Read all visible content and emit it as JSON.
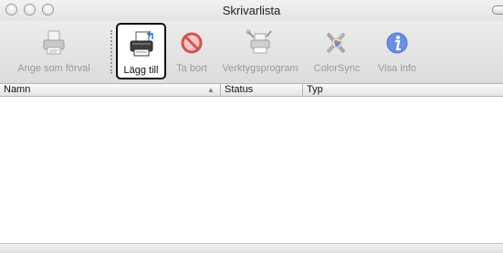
{
  "window": {
    "title": "Skrivarlista"
  },
  "toolbar": {
    "items": [
      {
        "label": "Ange som förval",
        "icon": "printer-default-icon",
        "enabled": false
      },
      {
        "label": "Lägg till",
        "icon": "add-printer-icon",
        "enabled": true,
        "selected": true
      },
      {
        "label": "Ta bort",
        "icon": "delete-icon",
        "enabled": false
      },
      {
        "label": "Verktygsprogram",
        "icon": "utility-icon",
        "enabled": false
      },
      {
        "label": "ColorSync",
        "icon": "colorsync-icon",
        "enabled": false
      },
      {
        "label": "Visa info",
        "icon": "info-icon",
        "enabled": false
      }
    ]
  },
  "table": {
    "columns": [
      "Namn",
      "Status",
      "Typ"
    ],
    "sort_indicator": "▲"
  },
  "colors": {
    "selected_border": "#111111",
    "disabled_text": "#9a9a9a",
    "delete_red": "#d65050",
    "info_blue": "#4a74d6"
  }
}
